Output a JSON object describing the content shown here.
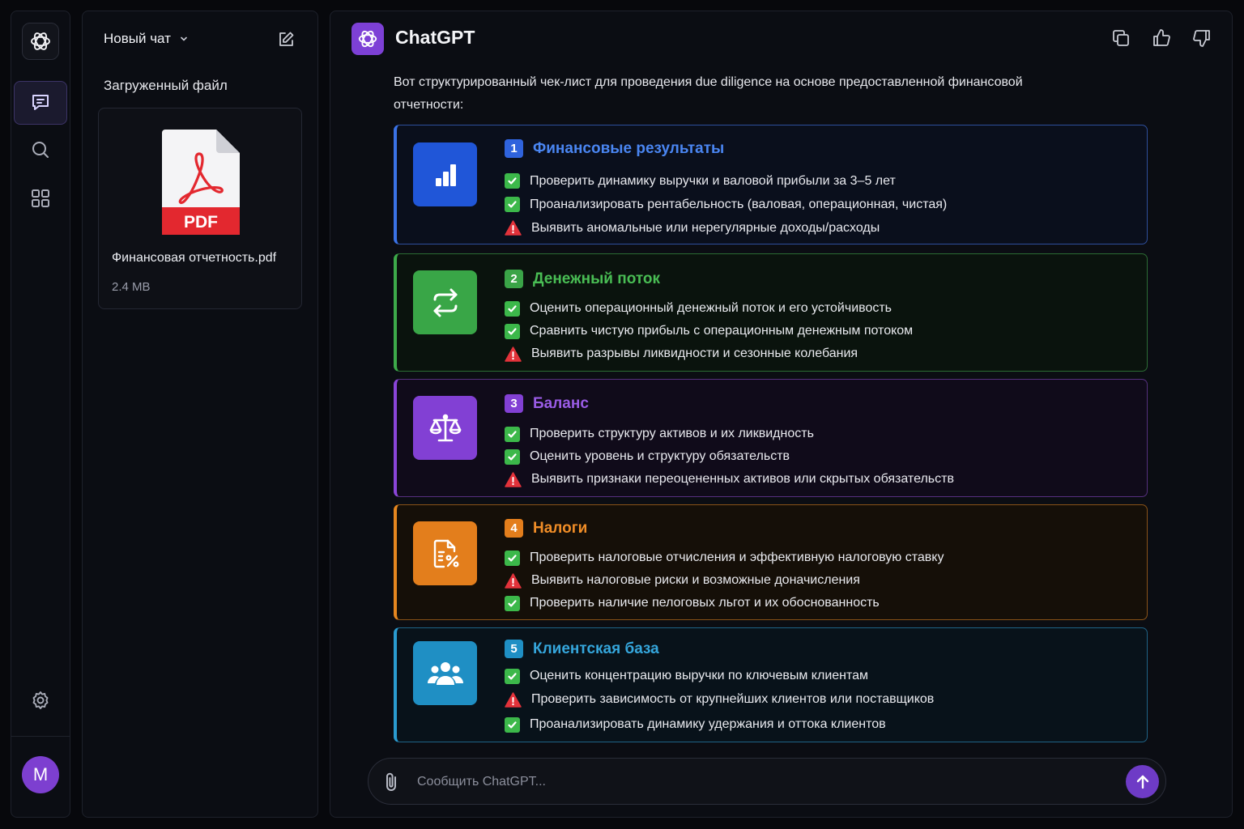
{
  "header": {
    "title": "ChatGPT"
  },
  "sidebar": {
    "chat_title": "Новый чат",
    "uploaded_label": "Загруженный файл",
    "file": {
      "badge": "PDF",
      "name": "Финансовая отчетность.pdf",
      "size": "2.4 MB"
    }
  },
  "user": {
    "initial": "M"
  },
  "message": {
    "intro": "Вот структурированный чек-лист для проведения due diligence на основе предоставленной финансовой отчетности:",
    "sections": [
      {
        "num": "1",
        "title": "Финансовые результаты",
        "color": "#3a72e6",
        "icon": "bar-chart-icon",
        "items": [
          {
            "status": "check",
            "text": "Проверить динамику выручки и валовой прибыли за 3–5 лет"
          },
          {
            "status": "check",
            "text": "Проанализировать рентабельность (валовая, операционная, чистая)"
          },
          {
            "status": "warning",
            "text": "Выявить аномальные или нерегулярные доходы/расходы"
          }
        ]
      },
      {
        "num": "2",
        "title": "Денежный поток",
        "color": "#3daa4a",
        "icon": "exchange-arrows-icon",
        "items": [
          {
            "status": "check",
            "text": "Оценить операционный денежный поток и его устойчивость"
          },
          {
            "status": "check",
            "text": "Сравнить чистую прибыль с операционным денежным потоком"
          },
          {
            "status": "warning",
            "text": "Выявить разрывы ликвидности и сезонные колебания"
          }
        ]
      },
      {
        "num": "3",
        "title": "Баланс",
        "color": "#8a45d8",
        "icon": "scales-icon",
        "items": [
          {
            "status": "check",
            "text": "Проверить структуру активов и их ликвидность"
          },
          {
            "status": "check",
            "text": "Оценить уровень и структуру обязательств"
          },
          {
            "status": "warning",
            "text": "Выявить признаки переоцененных активов или скрытых обязательств"
          }
        ]
      },
      {
        "num": "4",
        "title": "Налоги",
        "color": "#e5861f",
        "icon": "tax-document-icon",
        "items": [
          {
            "status": "check",
            "text": "Проверить налоговые отчисления и эффективную налоговую ставку"
          },
          {
            "status": "warning",
            "text": "Выявить налоговые риски и возможные доначисления"
          },
          {
            "status": "check",
            "text": "Проверить наличие пелоговых льгот и их обоснованность"
          }
        ]
      },
      {
        "num": "5",
        "title": "Клиентская база",
        "color": "#2a9bd0",
        "icon": "users-group-icon",
        "items": [
          {
            "status": "check",
            "text": "Оценить концентрацию выручки по ключевым клиентам"
          },
          {
            "status": "warning",
            "text": "Проверить зависимость от крупнейших клиентов или поставщиков"
          },
          {
            "status": "check",
            "text": "Проанализировать динамику удержания и оттока клиентов"
          }
        ]
      }
    ]
  },
  "composer": {
    "placeholder": "Сообщить ChatGPT..."
  }
}
